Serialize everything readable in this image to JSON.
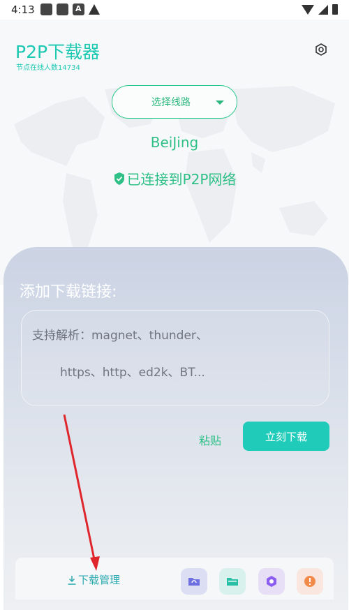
{
  "status_bar": {
    "time": "4:13"
  },
  "header": {
    "title": "P2P下载器",
    "subtitle": "节点在线人数14734"
  },
  "route": {
    "label": "选择线路"
  },
  "server": {
    "city": "BeiJing",
    "status": "已连接到P2P网络"
  },
  "add_link": {
    "title": "添加下载链接:",
    "placeholder_line1": "支持解析：magnet、thunder、",
    "placeholder_line2": "https、http、ed2k、BT..."
  },
  "actions": {
    "paste": "粘贴",
    "download_now": "立刻下载"
  },
  "bottom_nav": {
    "download_manager": "下载管理"
  },
  "colors": {
    "accent": "#1bc9b3",
    "green": "#2fc088",
    "button": "#20cbb9",
    "arrow": "#e0262d"
  }
}
